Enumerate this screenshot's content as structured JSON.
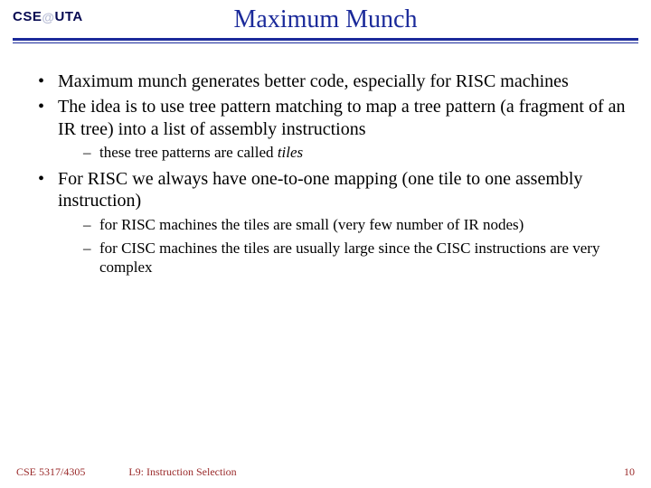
{
  "header": {
    "logo_left": "CSE",
    "logo_at": "@",
    "logo_right": "UTA",
    "title": "Maximum Munch"
  },
  "bullets": [
    {
      "text": "Maximum munch generates better code, especially for RISC machines",
      "sub": []
    },
    {
      "text": "The idea is to use tree pattern matching to map a tree pattern (a fragment of an IR tree) into a list of assembly instructions",
      "sub": [
        {
          "prefix": "these tree patterns are called ",
          "italic": "tiles",
          "suffix": ""
        }
      ]
    },
    {
      "text": "For RISC we always have one-to-one mapping (one tile to one assembly instruction)",
      "sub": [
        {
          "prefix": "for RISC machines the tiles are small (very few number of IR nodes)",
          "italic": "",
          "suffix": ""
        },
        {
          "prefix": "for CISC machines the tiles are usually large since the CISC instructions are very complex",
          "italic": "",
          "suffix": ""
        }
      ]
    }
  ],
  "footer": {
    "course": "CSE 5317/4305",
    "lecture": "L9: Instruction Selection",
    "page": "10"
  }
}
